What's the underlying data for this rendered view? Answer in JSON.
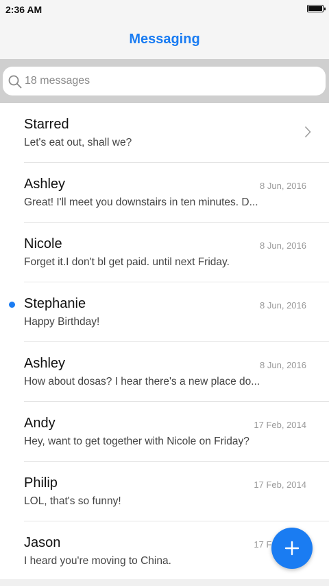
{
  "status": {
    "time": "2:36 AM"
  },
  "header": {
    "title": "Messaging"
  },
  "search": {
    "text": "18 messages"
  },
  "conversations": [
    {
      "name": "Starred",
      "preview": "Let's eat out, shall we?",
      "date": "",
      "unread": false,
      "chevron": true
    },
    {
      "name": "Ashley",
      "preview": "Great! I'll meet you downstairs in ten minutes. D...",
      "date": "8 Jun, 2016",
      "unread": false
    },
    {
      "name": "Nicole",
      "preview": "Forget it.I don't bl get paid. until next Friday.",
      "date": "8 Jun, 2016",
      "unread": false
    },
    {
      "name": "Stephanie",
      "preview": "Happy Birthday!",
      "date": "8 Jun, 2016",
      "unread": true
    },
    {
      "name": "Ashley",
      "preview": "How about dosas? I hear there's a new place do...",
      "date": "8 Jun, 2016",
      "unread": false
    },
    {
      "name": "Andy",
      "preview": "Hey, want to get together with Nicole on Friday?",
      "date": "17 Feb, 2014",
      "unread": false
    },
    {
      "name": "Philip",
      "preview": "LOL, that's so funny!",
      "date": "17 Feb, 2014",
      "unread": false
    },
    {
      "name": "Jason",
      "preview": "I heard you're moving to China.",
      "date": "17 Feb, 2014",
      "unread": false
    }
  ],
  "colors": {
    "accent": "#1a7cf2"
  },
  "icons": {
    "search": "search-icon",
    "chevron": "chevron-right-icon",
    "compose": "plus-icon"
  }
}
